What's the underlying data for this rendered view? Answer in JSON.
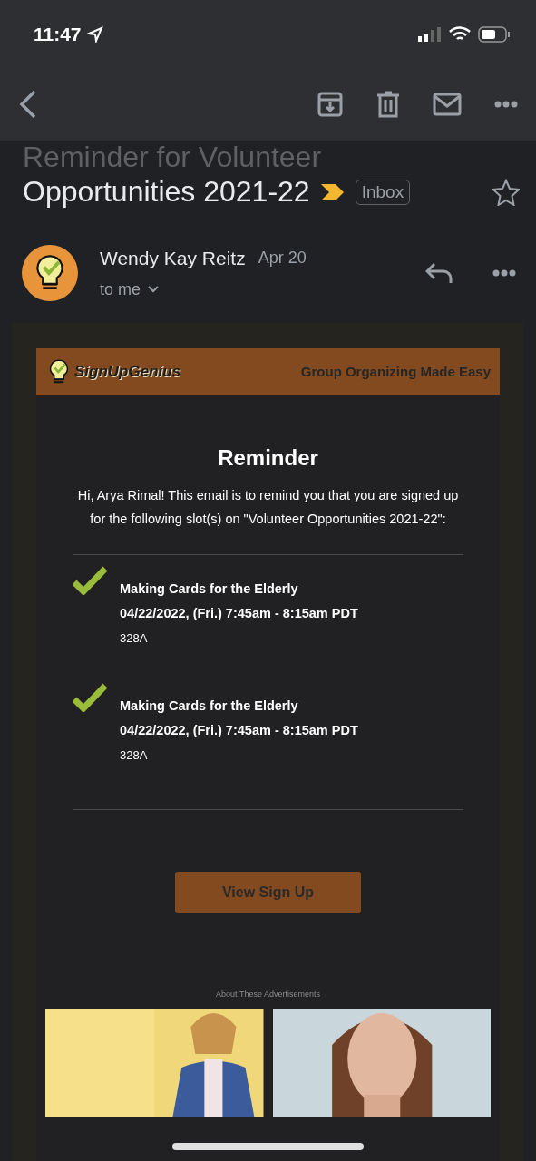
{
  "status_bar": {
    "time": "11:47"
  },
  "subject": {
    "line_1": "Reminder for Volunteer",
    "line_2": "Opportunities 2021-22",
    "label": "Inbox",
    "important": true,
    "starred": false
  },
  "sender": {
    "name": "Wendy Kay Reitz",
    "date": "Apr 20",
    "recipient": "to me"
  },
  "email": {
    "brand": "SignUpGenius",
    "tagline": "Group Organizing Made Easy",
    "heading": "Reminder",
    "intro": "Hi, Arya Rimal! This email is to remind you that you are signed up for the following slot(s) on \"Volunteer Opportunities 2021-22\":",
    "slots": [
      {
        "title": "Making Cards for the Elderly",
        "time": "04/22/2022, (Fri.) 7:45am - 8:15am PDT",
        "location": "328A"
      },
      {
        "title": "Making Cards for the Elderly",
        "time": "04/22/2022, (Fri.) 7:45am - 8:15am PDT",
        "location": "328A"
      }
    ],
    "button": "View Sign Up",
    "ads_link": "About These Advertisements"
  }
}
